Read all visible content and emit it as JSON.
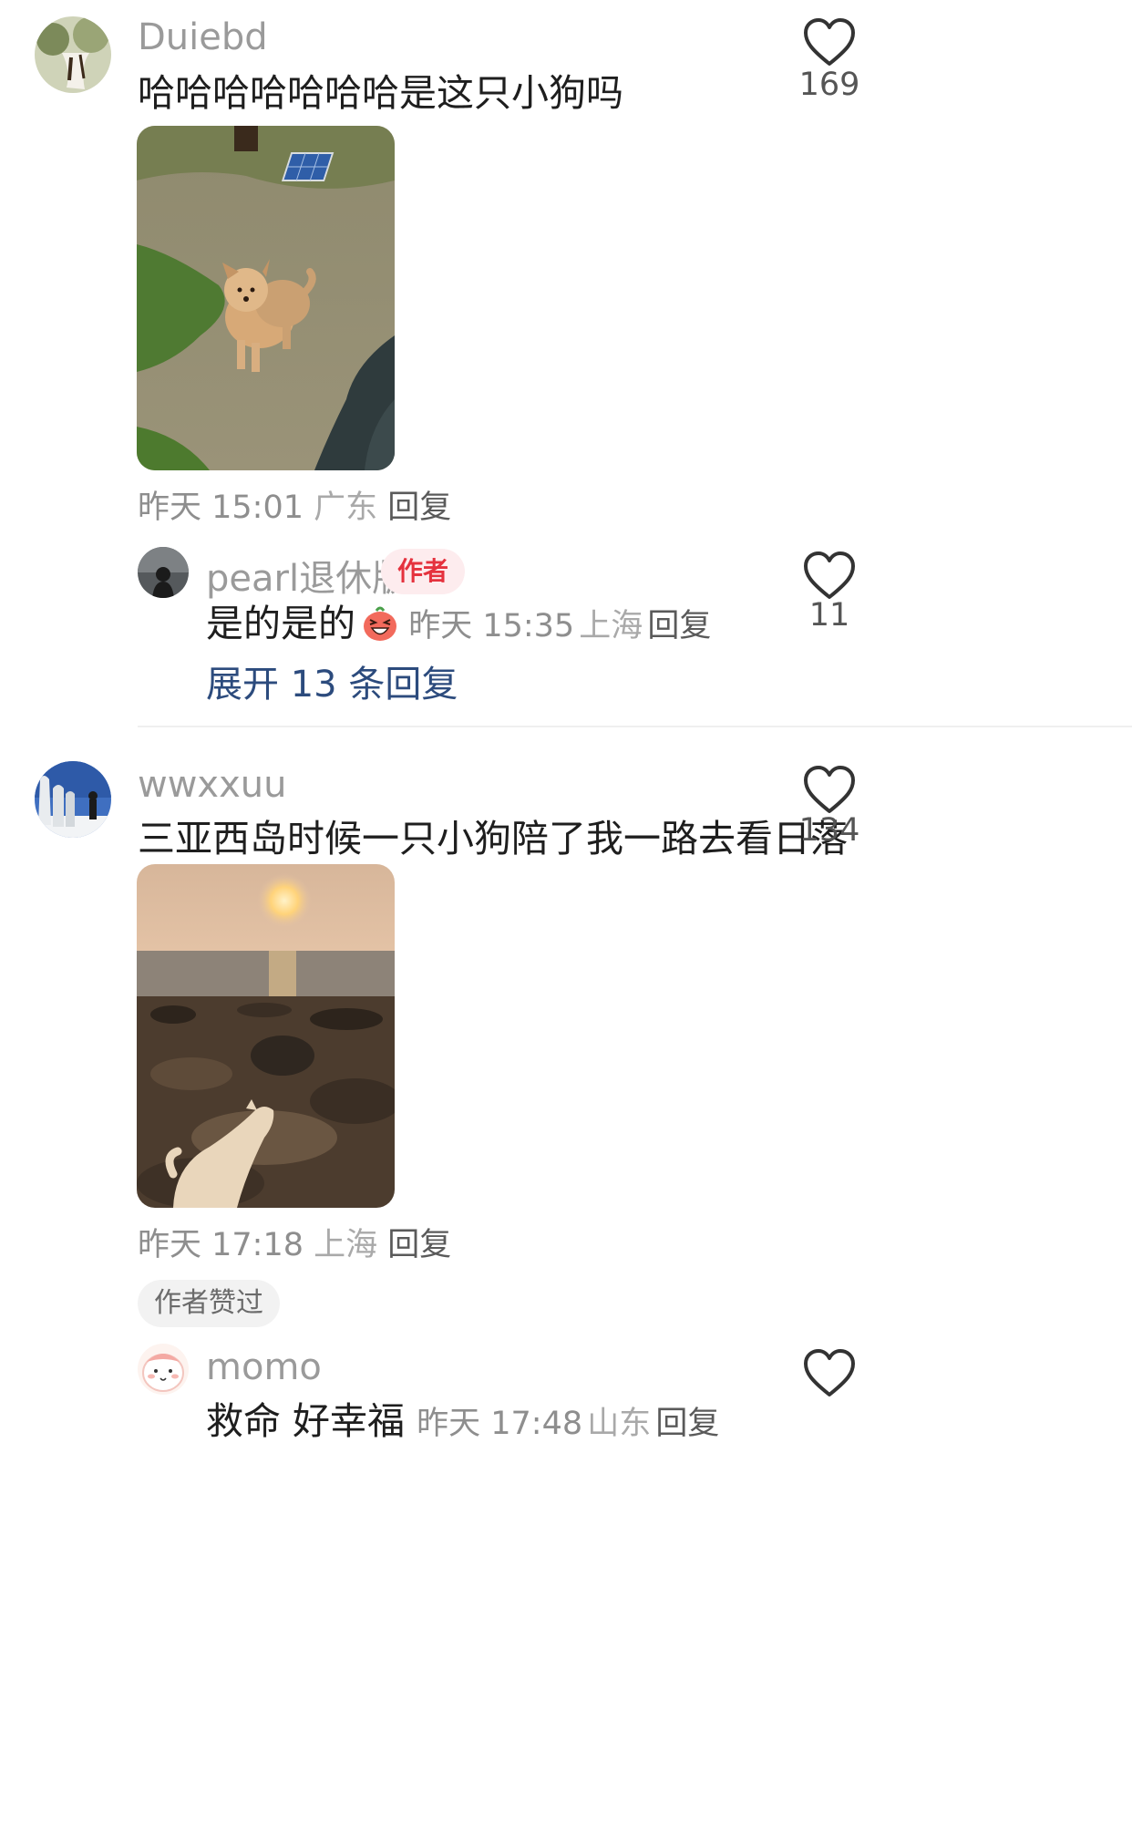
{
  "comments": [
    {
      "username": "Duiebd",
      "text": "哈哈哈哈哈哈哈是这只小狗吗",
      "likes": "169",
      "time": "昨天 15:01",
      "location": "广东",
      "reply_label": "回复",
      "replies": [
        {
          "username": "pearl退休版",
          "badge": "作者",
          "text": "是的是的",
          "time": "昨天 15:35",
          "location": "上海",
          "reply_label": "回复",
          "likes": "11"
        }
      ],
      "expand_label": "展开 13 条回复"
    },
    {
      "username": "wwxxuu",
      "text": "三亚西岛时候一只小狗陪了我一路去看日落",
      "likes": "134",
      "time": "昨天 17:18",
      "location": "上海",
      "reply_label": "回复",
      "liked_tag": "作者赞过",
      "replies": [
        {
          "username": "momo",
          "text": "救命 好幸福",
          "time": "昨天 17:48",
          "location": "山东",
          "reply_label": "回复"
        }
      ]
    }
  ],
  "icons": {
    "like": "heart-outline-icon",
    "emoji": "laughing-emoji-icon"
  },
  "colors": {
    "accent_link": "#2c4b7d",
    "author_badge": "#e5323e"
  }
}
